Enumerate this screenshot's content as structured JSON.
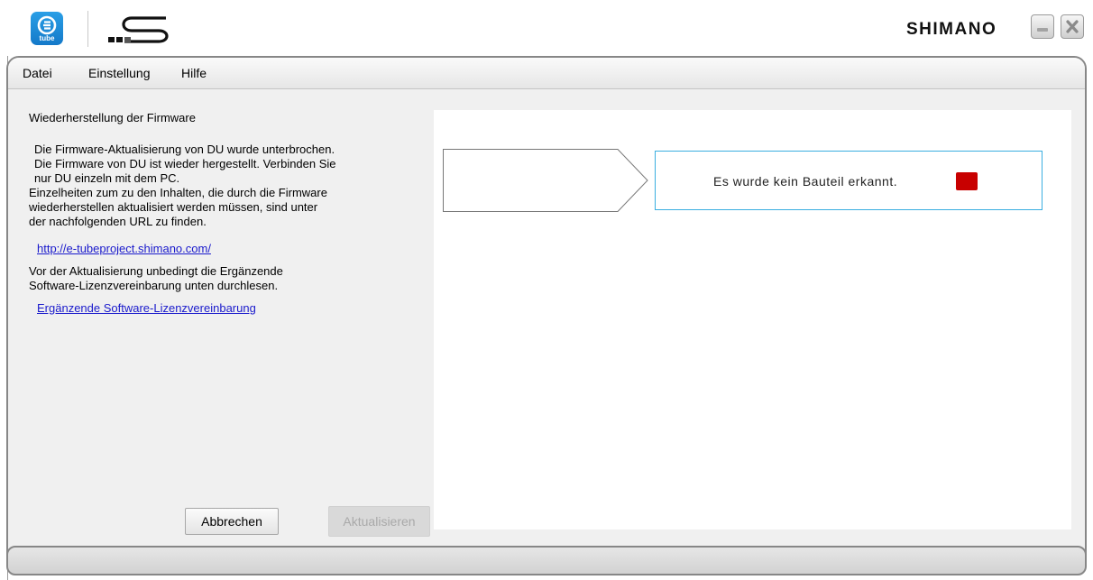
{
  "titlebar": {
    "app_logo_text": "tube",
    "brand": "SHIMANO",
    "icons": {
      "app": "e-tube-logo",
      "product": "di2-logo",
      "minimize": "minimize-icon",
      "close": "close-icon"
    }
  },
  "menu": {
    "items": [
      "Datei",
      "Einstellung",
      "Hilfe"
    ]
  },
  "left_panel": {
    "heading": "Wiederherstellung der Firmware",
    "message_lines": [
      "Die Firmware-Aktualisierung von DU wurde unterbrochen.",
      "Die Firmware von DU ist wieder hergestellt. Verbinden Sie",
      "nur DU einzeln mit dem PC.",
      "Einzelheiten zum zu den Inhalten, die durch die Firmware",
      "wiederherstellen aktualisiert werden müssen, sind unter",
      "der nachfolgenden URL zu finden."
    ],
    "url_link": "http://e-tubeproject.shimano.com/",
    "notice_lines": [
      "Vor der Aktualisierung unbedingt die Ergänzende",
      "Software-Lizenzvereinbarung unten durchlesen."
    ],
    "license_link": "Ergänzende Software-Lizenzvereinbarung",
    "buttons": {
      "cancel": "Abbrechen",
      "update": "Aktualisieren"
    }
  },
  "right_panel": {
    "status_text": "Es wurde kein Bauteil erkannt.",
    "status_color": "#c80000",
    "box_border_color": "#3aaee0"
  },
  "colors": {
    "frame_border": "#878787",
    "link": "#1a1acc",
    "panel_bg": "#f0f0f0"
  }
}
